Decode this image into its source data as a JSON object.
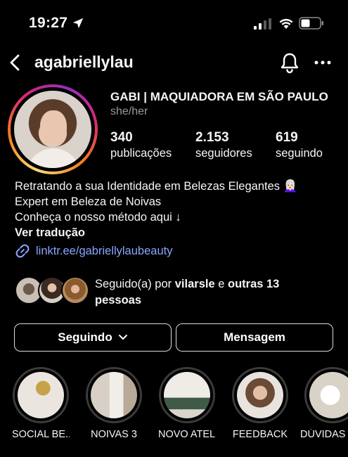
{
  "status_bar": {
    "time": "19:27"
  },
  "header": {
    "username": "agabriellylau"
  },
  "profile": {
    "full_name": "GABI | MAQUIADORA EM SÃO PAULO",
    "pronouns": "she/her",
    "stats": [
      {
        "value": "340",
        "label": "publicações"
      },
      {
        "value": "2.153",
        "label": "seguidores"
      },
      {
        "value": "619",
        "label": "seguindo"
      }
    ],
    "bio": [
      "Retratando a sua Identidade em Belezas Elegantes 👩🏻‍🦳",
      "Expert em Beleza de Noivas",
      "Conheça o nosso método aqui ↓"
    ],
    "translate_label": "Ver tradução",
    "link": "linktr.ee/gabriellylaubeauty"
  },
  "followed_by": {
    "prefix": "Seguido(a) por ",
    "user": "vilarsle",
    "connector": " e ",
    "others": "outras 13 pessoas"
  },
  "actions": {
    "following_label": "Seguindo",
    "message_label": "Mensagem"
  },
  "highlights": [
    {
      "label": "SOCIAL BE..."
    },
    {
      "label": "NOIVAS 3"
    },
    {
      "label": "NOVO ATELIÊ"
    },
    {
      "label": "FEEDBACK"
    },
    {
      "label": "DÚVIDAS"
    }
  ],
  "colors": {
    "background": "#000000",
    "link": "#8aa5ff",
    "secondary_text": "#9a9a9a",
    "button_border": "#dcdcdc"
  },
  "icons": [
    "location-arrow-icon",
    "signal-icon",
    "wifi-icon",
    "battery-icon",
    "back-icon",
    "bell-icon",
    "more-icon",
    "link-icon",
    "chevron-down-icon"
  ]
}
